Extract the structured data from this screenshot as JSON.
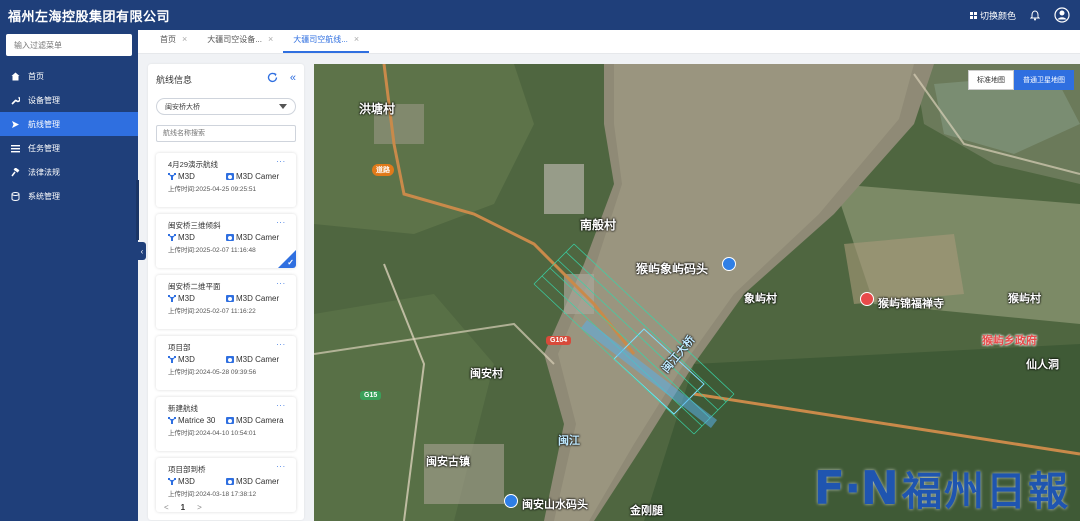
{
  "header": {
    "company": "福州左海控股集团有限公司",
    "theme_label": "切换颜色"
  },
  "sidebar": {
    "search_placeholder": "输入过滤菜单",
    "items": [
      {
        "label": "首页",
        "icon": "home-icon"
      },
      {
        "label": "设备管理",
        "icon": "wrench-icon"
      },
      {
        "label": "航线管理",
        "icon": "plane-icon",
        "active": true
      },
      {
        "label": "任务管理",
        "icon": "list-icon"
      },
      {
        "label": "法律法规",
        "icon": "gavel-icon"
      },
      {
        "label": "系统管理",
        "icon": "database-icon"
      }
    ]
  },
  "tabs": [
    {
      "label": "首页"
    },
    {
      "label": "大疆司空设备..."
    },
    {
      "label": "大疆司空航线...",
      "active": true
    }
  ],
  "panel": {
    "title": "航线信息",
    "selected_project": "闽安桥大桥",
    "search_placeholder": "航线名称搜索",
    "routes": [
      {
        "name": "4月29演示航线",
        "device": "M3D",
        "camera": "M3D Camer",
        "time": "上传时间:2025-04-25 09:25:51",
        "selected": false
      },
      {
        "name": "闽安桥三维倾斜",
        "device": "M3D",
        "camera": "M3D Camer",
        "time": "上传时间:2025-02-07 11:16:48",
        "selected": true
      },
      {
        "name": "闽安桥二维平面",
        "device": "M3D",
        "camera": "M3D Camer",
        "time": "上传时间:2025-02-07 11:16:22",
        "selected": false
      },
      {
        "name": "项目部",
        "device": "M3D",
        "camera": "M3D Camer",
        "time": "上传时间:2024-05-28 09:39:56",
        "selected": false
      },
      {
        "name": "新建航线",
        "device": "Matrice 30",
        "camera": "M3D Camera",
        "time": "上传时间:2024-04-10 10:54:01",
        "selected": false
      },
      {
        "name": "项目部到桥",
        "device": "M3D",
        "camera": "M3D Camer",
        "time": "上传时间:2024-03-18 17:38:12",
        "selected": false
      }
    ],
    "more": "...",
    "check": "✓",
    "pager": {
      "prev": "<",
      "current": "1",
      "next": ">"
    }
  },
  "map": {
    "toggle": [
      "标准地图",
      "普通卫星地图"
    ],
    "labels": {
      "hongtang": "洪塘村",
      "nanban": "南般村",
      "houyu_pier": "猴屿象屿码头",
      "xiangyu": "象屿村",
      "houyu_temple": "猴屿锦福禅寺",
      "houyu_village": "猴屿村",
      "houyu_gov": "猴屿乡政府",
      "xianren": "仙人洞",
      "minan": "闽安村",
      "minan_town": "闽安古镇",
      "river": "闽江",
      "pier2": "闽安山水码头",
      "jingang": "金刚腿",
      "bridge": "闽江大桥"
    },
    "shields": {
      "g104": "G104",
      "g15": "G15",
      "road": "道路"
    },
    "watermark_fn": "F·N",
    "watermark_cn": "福州日報"
  }
}
